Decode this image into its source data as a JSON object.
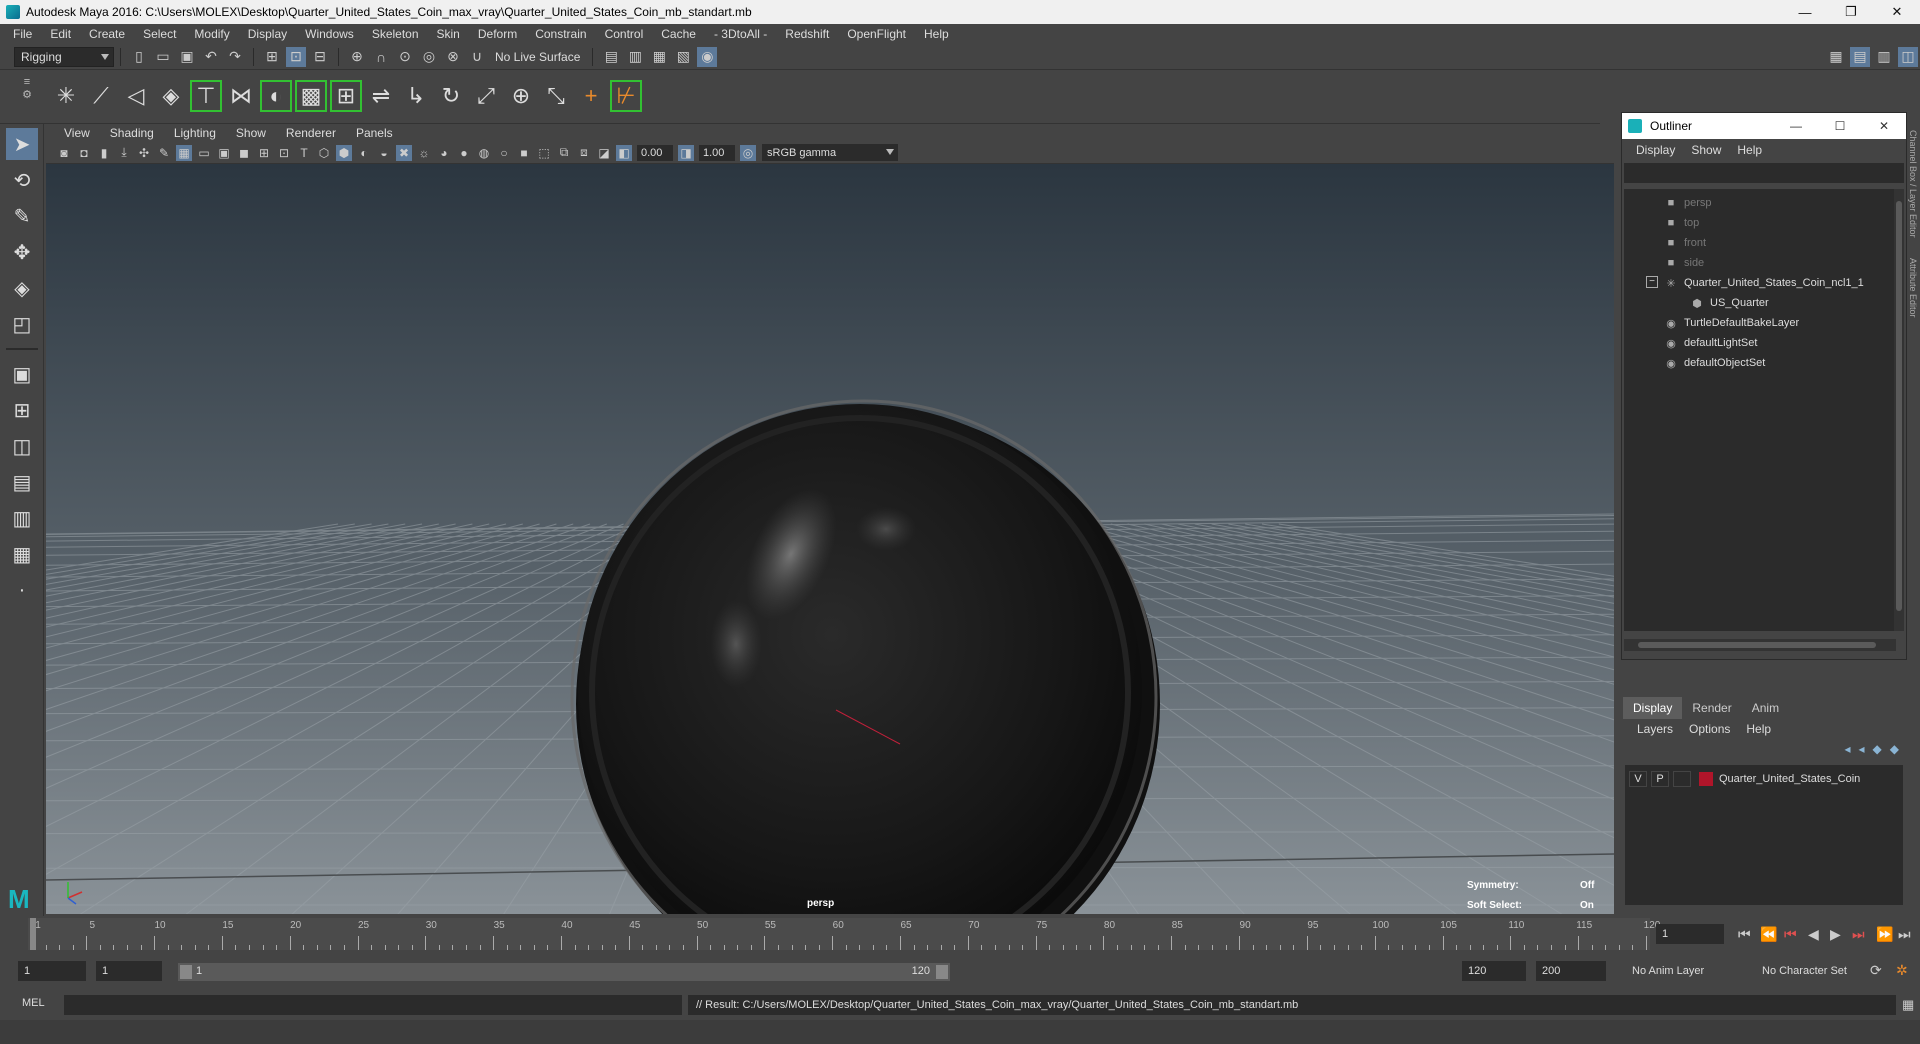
{
  "window": {
    "title": "Autodesk Maya 2016: C:\\Users\\MOLEX\\Desktop\\Quarter_United_States_Coin_max_vray\\Quarter_United_States_Coin_mb_standart.mb",
    "minimize": "—",
    "restore": "❐",
    "close": "✕"
  },
  "menubar": {
    "items": [
      "File",
      "Edit",
      "Create",
      "Select",
      "Modify",
      "Display",
      "Windows",
      "Skeleton",
      "Skin",
      "Deform",
      "Constrain",
      "Control",
      "Cache",
      "- 3DtoAll -",
      "Redshift",
      "OpenFlight",
      "Help"
    ]
  },
  "statusline": {
    "mode": "Rigging",
    "live_surface": "No Live Surface"
  },
  "viewport": {
    "menu": [
      "View",
      "Shading",
      "Lighting",
      "Show",
      "Renderer",
      "Panels"
    ],
    "exposure": "0.00",
    "gamma": "1.00",
    "color_space": "sRGB gamma",
    "camera": "persp",
    "hud": {
      "symmetry_label": "Symmetry:",
      "symmetry_value": "Off",
      "soft_select_label": "Soft Select:",
      "soft_select_value": "On"
    }
  },
  "outliner": {
    "title": "Outliner",
    "menu": [
      "Display",
      "Show",
      "Help"
    ],
    "items": [
      {
        "label": "persp",
        "icon": "camera-icon",
        "dim": true
      },
      {
        "label": "top",
        "icon": "camera-icon",
        "dim": true
      },
      {
        "label": "front",
        "icon": "camera-icon",
        "dim": true
      },
      {
        "label": "side",
        "icon": "camera-icon",
        "dim": true
      },
      {
        "label": "Quarter_United_States_Coin_ncl1_1",
        "icon": "joint-icon",
        "dim": false
      },
      {
        "label": "US_Quarter",
        "icon": "mesh-icon",
        "dim": false
      },
      {
        "label": "TurtleDefaultBakeLayer",
        "icon": "set-icon",
        "dim": false
      },
      {
        "label": "defaultLightSet",
        "icon": "set-icon",
        "dim": false
      },
      {
        "label": "defaultObjectSet",
        "icon": "set-icon",
        "dim": false
      }
    ]
  },
  "sidetabs": [
    "Channel Box / Layer Editor",
    "Attribute Editor"
  ],
  "layer_editor": {
    "tabs": [
      "Display",
      "Render",
      "Anim"
    ],
    "menu": [
      "Layers",
      "Options",
      "Help"
    ],
    "layer": {
      "v": "V",
      "p": "P",
      "name": "Quarter_United_States_Coin",
      "color": "#b0152a"
    }
  },
  "timeline": {
    "ticks": [
      "1",
      "5",
      "10",
      "15",
      "20",
      "25",
      "30",
      "35",
      "40",
      "45",
      "50",
      "55",
      "60",
      "65",
      "70",
      "75",
      "80",
      "85",
      "90",
      "95",
      "100",
      "105",
      "110",
      "115",
      "120"
    ],
    "current_frame": "1",
    "start": "1",
    "range_start": "1",
    "range_inner_start": "1",
    "range_inner_end": "120",
    "range_end": "120",
    "total_end": "200",
    "anim_layer": "No Anim Layer",
    "character_set": "No Character Set"
  },
  "cmdline": {
    "mode": "MEL",
    "result": "// Result: C:/Users/MOLEX/Desktop/Quarter_United_States_Coin_max_vray/Quarter_United_States_Coin_mb_standart.mb"
  }
}
